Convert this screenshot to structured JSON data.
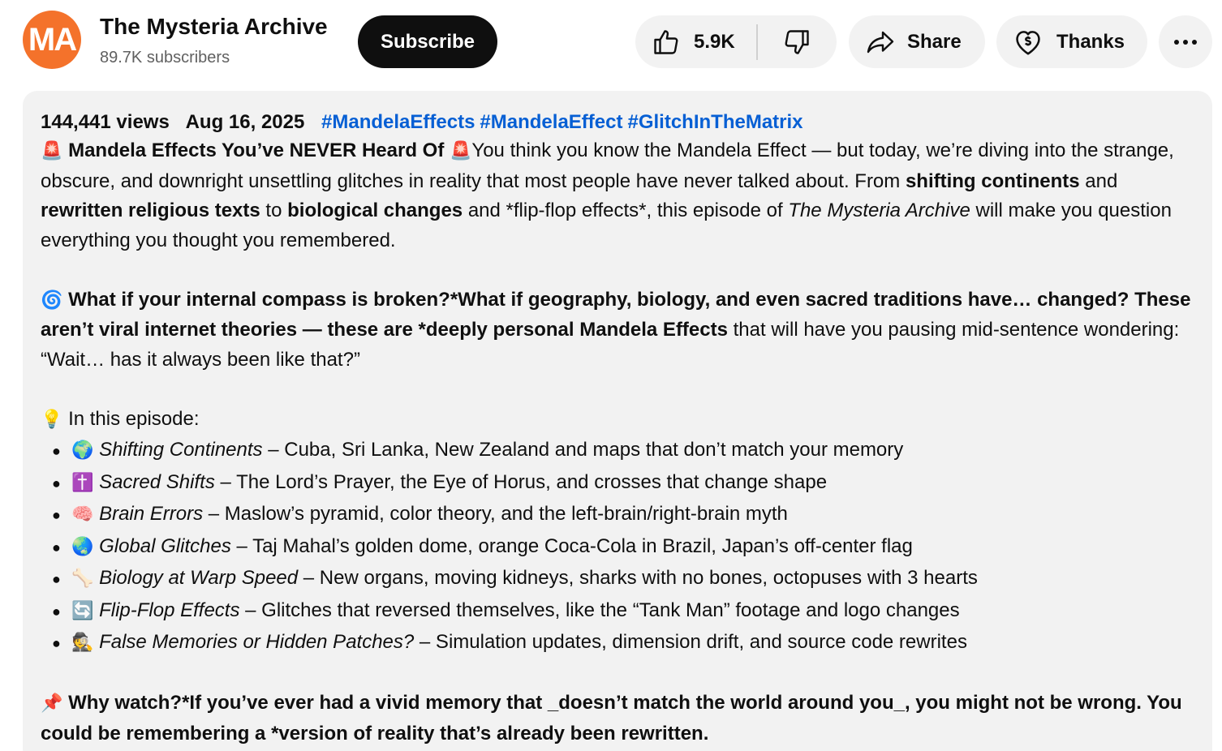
{
  "channel": {
    "avatar_text": "MA",
    "name": "The Mysteria Archive",
    "subscribers": "89.7K subscribers",
    "subscribe_label": "Subscribe"
  },
  "actions": {
    "like_count": "5.9K",
    "share_label": "Share",
    "thanks_label": "Thanks",
    "more_label": "···"
  },
  "colors": {
    "accent_link": "#065fd4",
    "avatar_bg": "#f4722b",
    "panel_bg": "#f2f2f2"
  },
  "description": {
    "views": "144,441 views",
    "date": "Aug 16, 2025",
    "hashtags": [
      "#MandelaEffects",
      "#MandelaEffect",
      "#GlitchInTheMatrix"
    ],
    "p1": {
      "emoji": "🚨",
      "title": "Mandela Effects You’ve NEVER Heard Of",
      "t1": "You think you know the Mandela Effect — but today, we’re diving into the strange, obscure, and downright unsettling glitches in reality that most people have never talked about. From ",
      "b1": "shifting continents",
      "t2": " and ",
      "b2": "rewritten religious texts",
      "t3": " to ",
      "b3": "biological changes",
      "t4": " and *flip-flop effects*, this episode of ",
      "i1": "The Mysteria Archive",
      "t5": " will make you question everything you thought you remembered."
    },
    "p2": {
      "emoji": "🌀",
      "bold": "What if your internal compass is broken?*What if geography, biology, and even sacred traditions have… changed? These aren’t viral internet theories — these are *deeply personal Mandela Effects",
      "rest": " that will have you pausing mid-sentence wondering: “Wait… has it always been like that?”"
    },
    "episode_intro": {
      "emoji": "💡",
      "text": "In this episode:"
    },
    "episode_items": [
      {
        "emoji": "🌍",
        "title": "Shifting Continents",
        "text": " – Cuba, Sri Lanka, New Zealand and maps that don’t match your memory"
      },
      {
        "emoji": "✝️",
        "title": "Sacred Shifts",
        "text": " – The Lord’s Prayer, the Eye of Horus, and crosses that change shape"
      },
      {
        "emoji": "🧠",
        "title": "Brain Errors",
        "text": " – Maslow’s pyramid, color theory, and the left-brain/right-brain myth"
      },
      {
        "emoji": "🌏",
        "title": "Global Glitches",
        "text": " – Taj Mahal’s golden dome, orange Coca-Cola in Brazil, Japan’s off-center flag"
      },
      {
        "emoji": "🦴",
        "title": "Biology at Warp Speed",
        "text": " – New organs, moving kidneys, sharks with no bones, octopuses with 3 hearts"
      },
      {
        "emoji": "🔄",
        "title": "Flip-Flop Effects",
        "text": " – Glitches that reversed themselves, like the “Tank Man” footage and logo changes"
      },
      {
        "emoji": "🕵️",
        "title": "False Memories or Hidden Patches?",
        "text": " – Simulation updates, dimension drift, and source code rewrites"
      }
    ],
    "p3": {
      "emoji": "📌",
      "bold": "Why watch?*If you’ve ever had a vivid memory that _doesn’t match the world around you_, you might not be wrong. You could be remembering a *version of reality that’s already been rewritten."
    }
  }
}
